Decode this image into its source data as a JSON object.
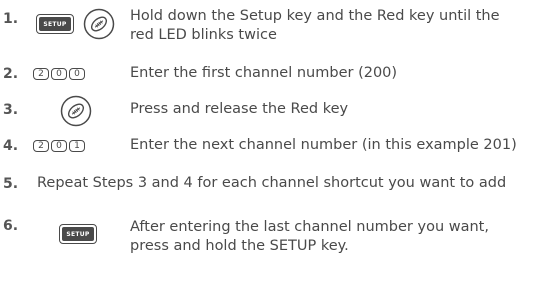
{
  "steps": [
    {
      "number": "1.",
      "key_label": "SETUP",
      "icon": "red-key-icon",
      "lines": [
        "Hold down the Setup key and the Red key until the",
        "red LED blinks twice"
      ]
    },
    {
      "number": "2.",
      "digits": [
        "2",
        "0",
        "0"
      ],
      "text": "Enter the first channel number (200)"
    },
    {
      "number": "3.",
      "icon": "red-key-icon",
      "text": "Press and release the Red key"
    },
    {
      "number": "4.",
      "digits": [
        "2",
        "0",
        "1"
      ],
      "text": "Enter the next channel number (in this example 201)"
    },
    {
      "number": "5.",
      "text": "Repeat Steps 3 and 4 for each channel shortcut you want to add"
    },
    {
      "number": "6.",
      "key_label": "SETUP",
      "lines": [
        "After entering the last channel number you want,",
        "press and hold the SETUP key."
      ]
    }
  ]
}
